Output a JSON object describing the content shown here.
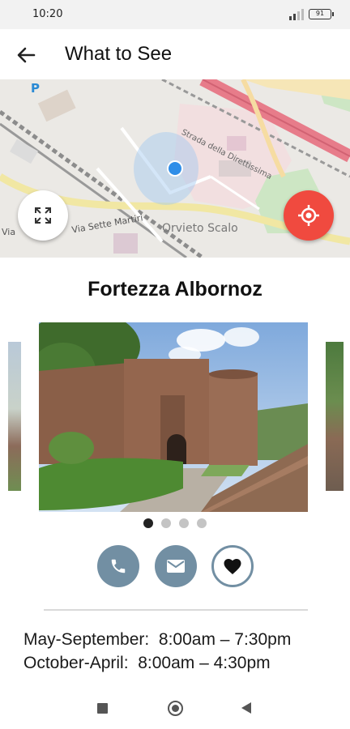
{
  "status_bar": {
    "time": "10:20",
    "battery": "91"
  },
  "app_bar": {
    "title": "What to See",
    "back_icon": "arrow-left-icon"
  },
  "map": {
    "street_labels": [
      "Strada della Direttissima",
      "Via Sette Martiri",
      "Via"
    ],
    "place_label": "Orvieto Scalo",
    "parking_label": "P",
    "fullscreen_icon": "expand-icon",
    "locate_icon": "gps-target-icon",
    "locate_color": "#f04a3f"
  },
  "poi": {
    "title": "Fortezza Albornoz"
  },
  "carousel": {
    "page_count": 4,
    "active_index": 0
  },
  "actions": {
    "phone_icon": "phone-icon",
    "mail_icon": "mail-icon",
    "favorite_icon": "heart-icon",
    "accent_color": "#728fa3"
  },
  "hours": {
    "rows": [
      "May-September:  8:00am – 7:30pm",
      "October-April:  8:00am – 4:30pm"
    ]
  },
  "nav_bar": {
    "recents_icon": "square-icon",
    "home_icon": "circle-icon",
    "back_icon": "triangle-back-icon"
  }
}
